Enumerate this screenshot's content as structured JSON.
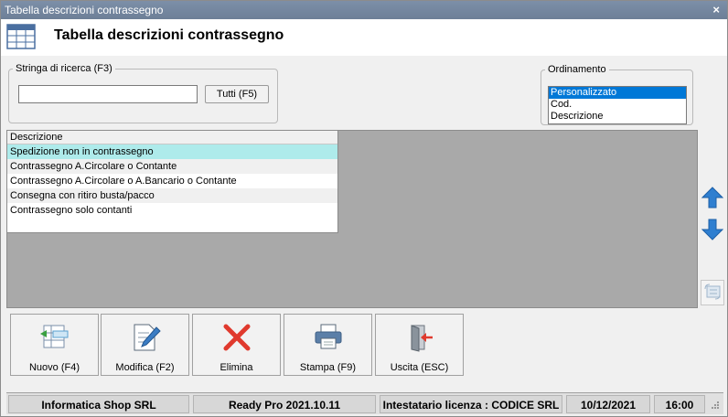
{
  "window": {
    "title": "Tabella descrizioni contrassegno",
    "close_glyph": "×"
  },
  "header": {
    "title": "Tabella descrizioni contrassegno",
    "icon": "table-icon"
  },
  "search": {
    "legend": "Stringa di ricerca (F3)",
    "value": "",
    "placeholder": "",
    "all_button_label": "Tutti (F5)"
  },
  "ordering": {
    "legend": "Ordinamento",
    "options": [
      "Personalizzato",
      "Cod.",
      "Descrizione"
    ],
    "selected": "Personalizzato"
  },
  "grid": {
    "column_header": "Descrizione",
    "rows": [
      "Spedizione non in contrassegno",
      "Contrassegno A.Circolare o Contante",
      "Contrassegno A.Circolare o A.Bancario o Contante",
      "Consegna con ritiro busta/pacco",
      "Contrassegno solo contanti"
    ],
    "selected_row": 0
  },
  "side_buttons": {
    "up": "arrow-up-icon",
    "down": "arrow-down-icon",
    "reorder": "reorder-icon"
  },
  "toolbar": {
    "new_label": "Nuovo (F4)",
    "edit_label": "Modifica (F2)",
    "delete_label": "Elimina",
    "print_label": "Stampa (F9)",
    "exit_label": "Uscita (ESC)"
  },
  "status": {
    "company": "Informatica Shop SRL",
    "product": "Ready Pro 2021.10.11",
    "license": "Intestatario licenza : CODICE SRL",
    "date": "10/12/2021",
    "time": "16:00"
  },
  "colors": {
    "titlebar": "#7c8fa8",
    "selected_row": "#aeebeb",
    "list_selection": "#0078d7",
    "grid_background": "#a9a9a9",
    "arrow_blue": "#2f7fd0",
    "delete_red": "#e03a2e"
  }
}
